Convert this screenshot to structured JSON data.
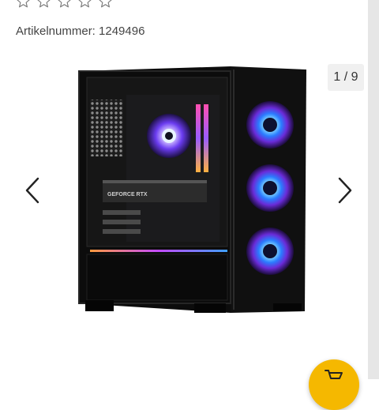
{
  "rating": {
    "stars_total": 5,
    "stars_filled": 0
  },
  "article": {
    "label": "Artikelnummer: 1249496"
  },
  "gallery": {
    "counter": "1 / 9",
    "image_alt": "Gaming PC tower",
    "gpu_label": "GEFORCE RTX",
    "prev_icon": "chevron-left-icon",
    "next_icon": "chevron-right-icon"
  },
  "fab": {
    "icon": "cart-icon",
    "color": "#f5b800"
  }
}
